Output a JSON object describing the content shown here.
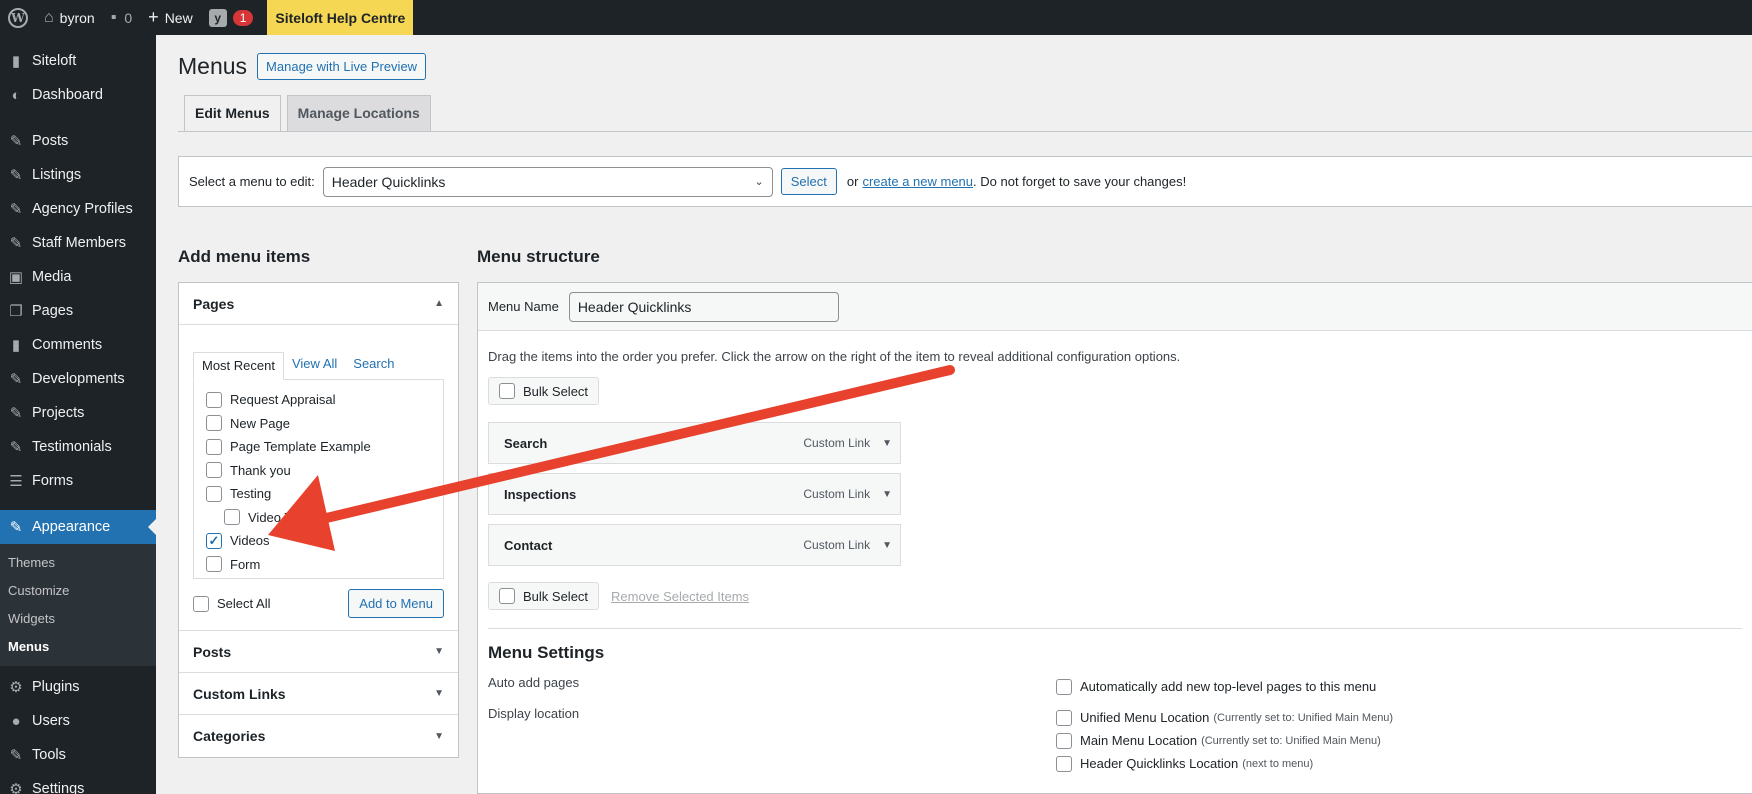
{
  "adminbar": {
    "site_name": "byron",
    "comments_count": "0",
    "new_label": "New",
    "notification_count": "1",
    "help_label": "Siteloft Help Centre"
  },
  "sidebar": {
    "items_top": [
      {
        "label": "Siteloft",
        "icon": "speech-bubble-icon"
      },
      {
        "label": "Dashboard",
        "icon": "dashboard-icon"
      }
    ],
    "items_mid": [
      {
        "label": "Posts",
        "icon": "pin-icon"
      },
      {
        "label": "Listings",
        "icon": "pin-icon"
      },
      {
        "label": "Agency Profiles",
        "icon": "pin-icon"
      },
      {
        "label": "Staff Members",
        "icon": "pin-icon"
      },
      {
        "label": "Media",
        "icon": "media-icon"
      },
      {
        "label": "Pages",
        "icon": "page-icon"
      },
      {
        "label": "Comments",
        "icon": "comment-icon"
      },
      {
        "label": "Developments",
        "icon": "pin-icon"
      },
      {
        "label": "Projects",
        "icon": "pin-icon"
      },
      {
        "label": "Testimonials",
        "icon": "pin-icon"
      },
      {
        "label": "Forms",
        "icon": "forms-icon"
      }
    ],
    "active": {
      "label": "Appearance",
      "icon": "paintbrush-icon"
    },
    "submenu": [
      "Themes",
      "Customize",
      "Widgets",
      "Menus"
    ],
    "items_bottom": [
      {
        "label": "Plugins",
        "icon": "plugin-icon"
      },
      {
        "label": "Users",
        "icon": "user-icon"
      },
      {
        "label": "Tools",
        "icon": "wrench-icon"
      },
      {
        "label": "Settings",
        "icon": "settings-icon"
      }
    ]
  },
  "header": {
    "title": "Menus",
    "live_preview_label": "Manage with Live Preview",
    "tabs": [
      "Edit Menus",
      "Manage Locations"
    ]
  },
  "select_menu": {
    "label": "Select a menu to edit:",
    "selected": "Header Quicklinks",
    "button": "Select",
    "or_text": "or",
    "create_link": "create a new menu",
    "after_text": ". Do not forget to save your changes!"
  },
  "add_items": {
    "heading": "Add menu items",
    "pages": {
      "title": "Pages",
      "tabs": [
        "Most Recent",
        "View All",
        "Search"
      ],
      "items": [
        {
          "label": "Request Appraisal",
          "checked": false,
          "indent": false
        },
        {
          "label": "New Page",
          "checked": false,
          "indent": false
        },
        {
          "label": "Page Template Example",
          "checked": false,
          "indent": false
        },
        {
          "label": "Thank you",
          "checked": false,
          "indent": false
        },
        {
          "label": "Testing",
          "checked": false,
          "indent": false
        },
        {
          "label": "Video Te",
          "checked": false,
          "indent": true
        },
        {
          "label": "Videos",
          "checked": true,
          "indent": false
        },
        {
          "label": "Form",
          "checked": false,
          "indent": false
        }
      ],
      "select_all": "Select All",
      "add_button": "Add to Menu"
    },
    "sections": [
      "Posts",
      "Custom Links",
      "Categories"
    ]
  },
  "structure": {
    "heading": "Menu structure",
    "name_label": "Menu Name",
    "name_value": "Header Quicklinks",
    "instructions": "Drag the items into the order you prefer. Click the arrow on the right of the item to reveal additional configuration options.",
    "bulk_select": "Bulk Select",
    "items": [
      {
        "title": "Search",
        "type": "Custom Link"
      },
      {
        "title": "Inspections",
        "type": "Custom Link"
      },
      {
        "title": "Contact",
        "type": "Custom Link"
      }
    ],
    "remove_selected": "Remove Selected Items"
  },
  "settings": {
    "title": "Menu Settings",
    "auto_add_label": "Auto add pages",
    "auto_add_option": "Automatically add new top-level pages to this menu",
    "display_label": "Display location",
    "locations": [
      {
        "name": "Unified Menu Location",
        "note": "(Currently set to: Unified Main Menu)"
      },
      {
        "name": "Main Menu Location",
        "note": "(Currently set to: Unified Main Menu)"
      },
      {
        "name": "Header Quicklinks Location",
        "note": "(next to menu)"
      }
    ]
  },
  "colors": {
    "admin_dark": "#1d2327",
    "accent": "#2271b1",
    "help_yellow": "#f5d754",
    "annotation_red": "#e8412d"
  }
}
